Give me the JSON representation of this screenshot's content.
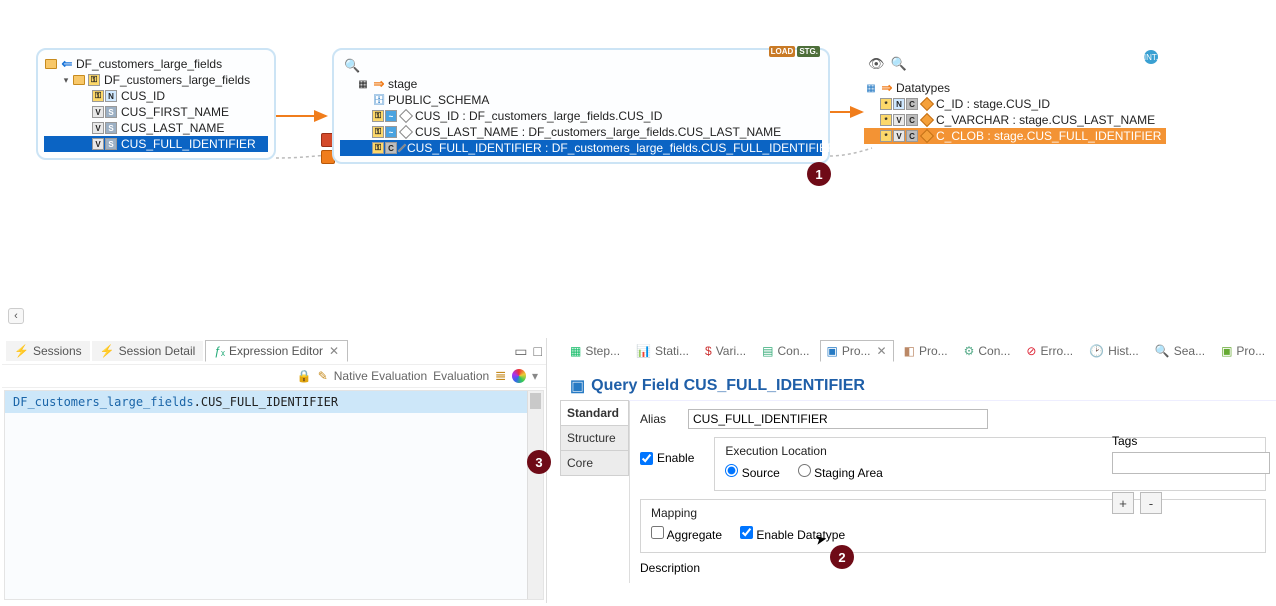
{
  "source_box": {
    "title": "DF_customers_large_fields",
    "child_title": "DF_customers_large_fields",
    "columns": [
      "CUS_ID",
      "CUS_FIRST_NAME",
      "CUS_LAST_NAME",
      "CUS_FULL_IDENTIFIER"
    ],
    "selected": "CUS_FULL_IDENTIFIER"
  },
  "stage_box": {
    "header": "stage",
    "schema": "PUBLIC_SCHEMA",
    "mappings": [
      "CUS_ID : DF_customers_large_fields.CUS_ID",
      "CUS_LAST_NAME : DF_customers_large_fields.CUS_LAST_NAME",
      "CUS_FULL_IDENTIFIER : DF_customers_large_fields.CUS_FULL_IDENTIFIER"
    ],
    "selected_index": 2,
    "badges": {
      "load": "LOAD",
      "stg": "STG."
    }
  },
  "target_box": {
    "title": "Datatypes",
    "rows": [
      "C_ID : stage.CUS_ID",
      "C_VARCHAR : stage.CUS_LAST_NAME",
      "C_CLOB : stage.CUS_FULL_IDENTIFIER"
    ],
    "selected_index": 2,
    "int_badge": "INT."
  },
  "markers": {
    "m1": "1",
    "m2": "2",
    "m3": "3"
  },
  "left_tabs": {
    "sessions": "Sessions",
    "session_detail": "Session Detail",
    "expression_editor": "Expression Editor"
  },
  "editor_toolbar": {
    "native_eval": "Native Evaluation",
    "evaluation": "Evaluation"
  },
  "code_line_a": "DF_customers_large_fields",
  "code_line_b": ".CUS_FULL_IDENTIFIER",
  "right_tabs": [
    "Step...",
    "Stati...",
    "Vari...",
    "Con...",
    "Pro...",
    "Pro...",
    "Con...",
    "Erro...",
    "Hist...",
    "Sea...",
    "Pro..."
  ],
  "right_active_index": 4,
  "query_field": {
    "title_prefix": "Query Field ",
    "title_value": "CUS_FULL_IDENTIFIER",
    "side_tabs": [
      "Standard",
      "Structure",
      "Core"
    ],
    "alias_label": "Alias",
    "alias_value": "CUS_FULL_IDENTIFIER",
    "enable_label": "Enable",
    "exec_loc_label": "Execution Location",
    "exec_source": "Source",
    "exec_staging": "Staging Area",
    "mapping_label": "Mapping",
    "aggregate_label": "Aggregate",
    "enable_dt_label": "Enable Datatype",
    "description_label": "Description",
    "tags_label": "Tags",
    "btn_plus": "+",
    "btn_minus": "-"
  }
}
